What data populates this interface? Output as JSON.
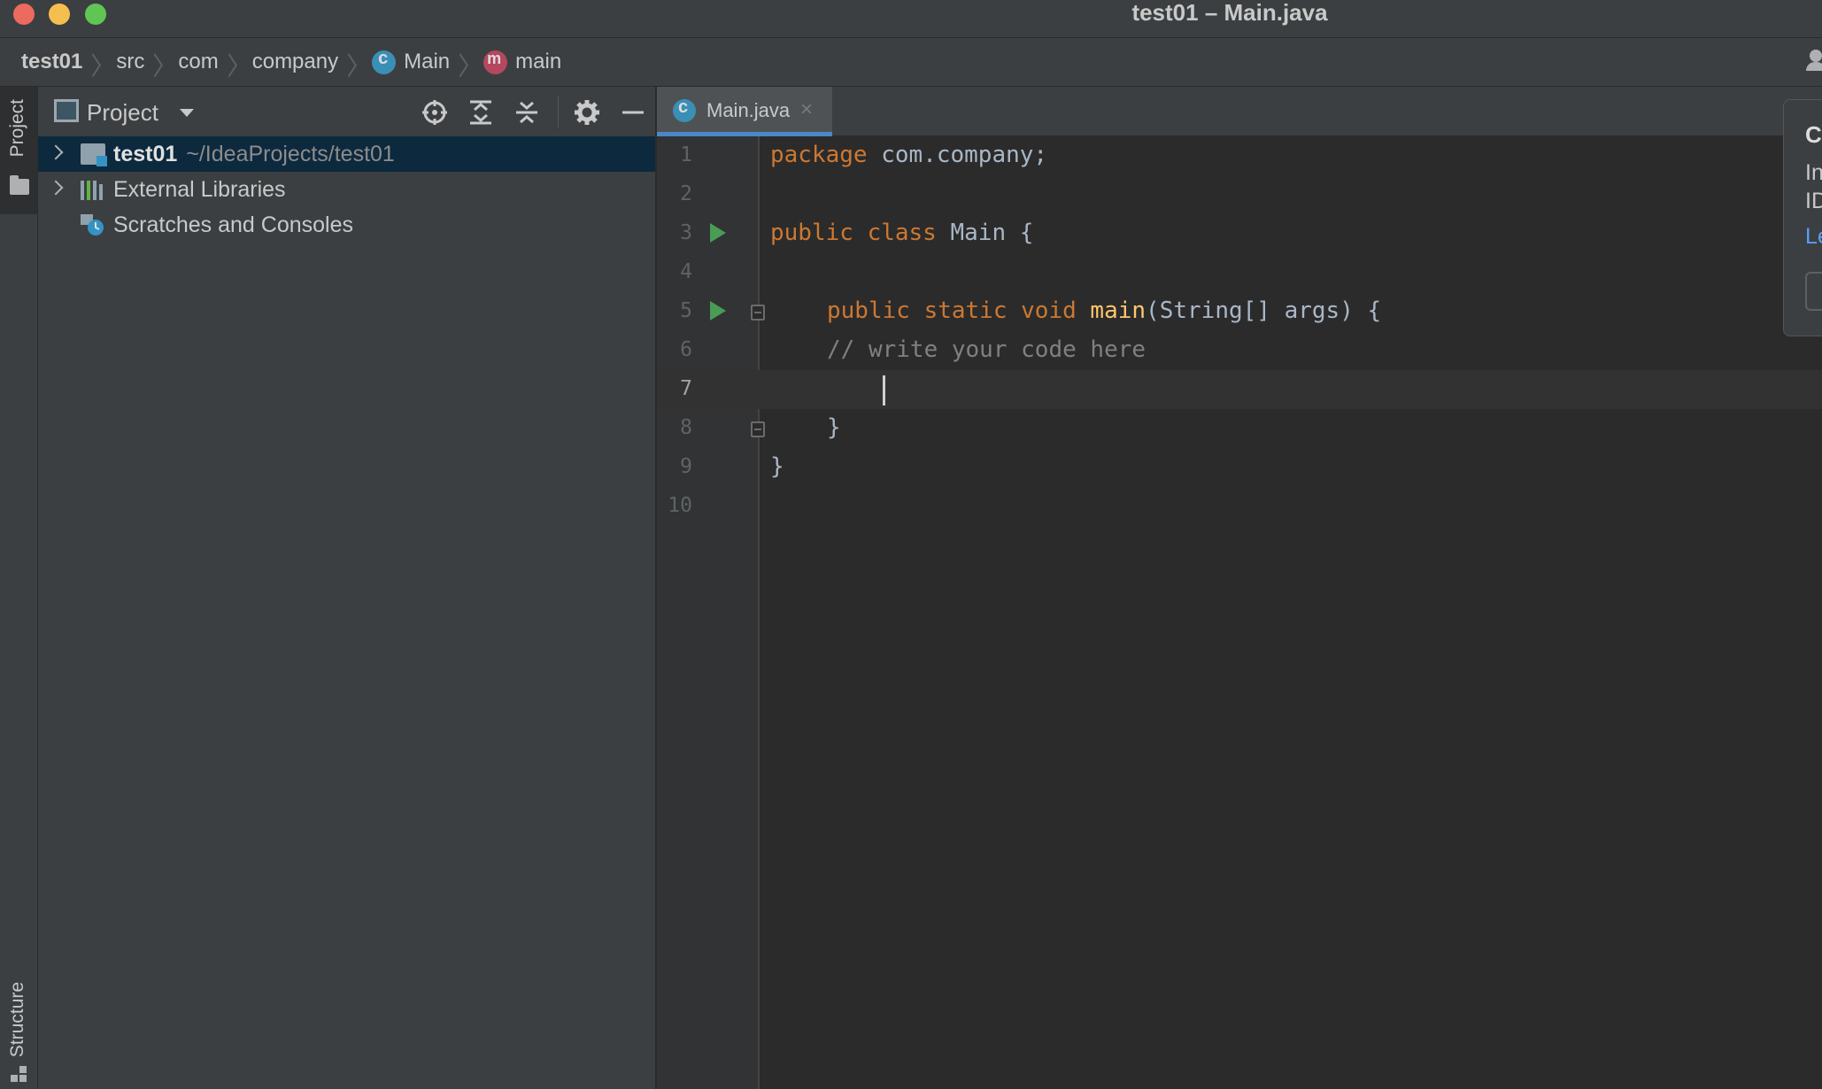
{
  "window": {
    "title": "test01 – Main.java",
    "traffic_colors": {
      "close": "#ed6a5e",
      "minimize": "#f5bf4f",
      "maximize": "#61c554"
    }
  },
  "breadcrumbs": [
    "test01",
    "src",
    "com",
    "company",
    "Main",
    "main"
  ],
  "tool_stripe": {
    "top_tab": "Project",
    "bottom_tab": "Structure"
  },
  "project_panel": {
    "title": "Project",
    "tree": [
      {
        "name": "test01",
        "path": "~/IdeaProjects/test01",
        "expandable": true,
        "selected": true
      },
      {
        "name": "External Libraries",
        "expandable": true,
        "selected": false
      },
      {
        "name": "Scratches and Consoles",
        "expandable": false,
        "selected": false
      }
    ]
  },
  "editor": {
    "tab_label": "Main.java",
    "tab_close": "×",
    "current_line": 7,
    "line_numbers": [
      "1",
      "2",
      "3",
      "4",
      "5",
      "6",
      "7",
      "8",
      "9",
      "10"
    ],
    "code": {
      "l1_kw": "package",
      "l1_rest": " com.company;",
      "l3_kw": "public class",
      "l3_rest": " Main {",
      "l5_kw": "public static void",
      "l5_fn": "main",
      "l5_rest": "(String[] args) {",
      "l6_comment": "// write your code here",
      "l8_brace": "}",
      "l9_brace": "}"
    }
  },
  "popup": {
    "title": "C",
    "body_line1": "In",
    "body_line2": "ID",
    "link": "Le"
  },
  "colors": {
    "keyword": "#cc7832",
    "function": "#ffc66d",
    "comment": "#808080",
    "accent": "#4a88c7"
  }
}
